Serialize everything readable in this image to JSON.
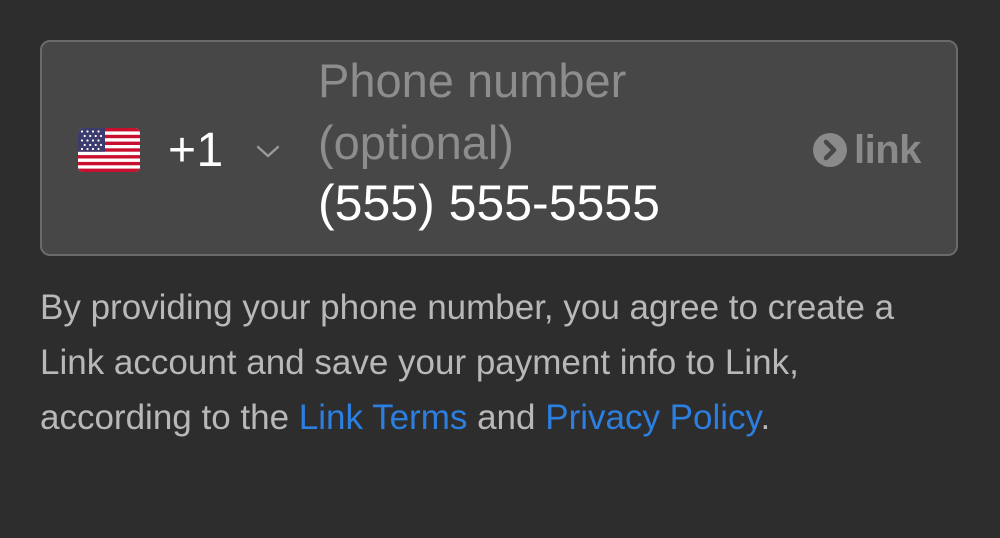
{
  "phone_field": {
    "flag_icon": "us-flag-icon",
    "dial_code": "+1",
    "chevron_icon": "chevron-down-icon",
    "label": "Phone number (optional)",
    "placeholder": "(555) 555-5555",
    "value": "",
    "logo_text": "link",
    "logo_icon": "link-arrow-icon"
  },
  "consent": {
    "text_before": "By providing your phone number, you agree to create a Link account and save your payment info to Link, according to the ",
    "terms_link": "Link Terms",
    "text_between": " and ",
    "privacy_link": "Privacy Policy",
    "text_after": "."
  },
  "colors": {
    "background": "#2d2d2d",
    "field_background": "#474747",
    "field_border": "#6a6a6a",
    "link_blue": "#2b7fe0",
    "muted_text": "#b8b8b8",
    "label_text": "#8d8d8d"
  }
}
